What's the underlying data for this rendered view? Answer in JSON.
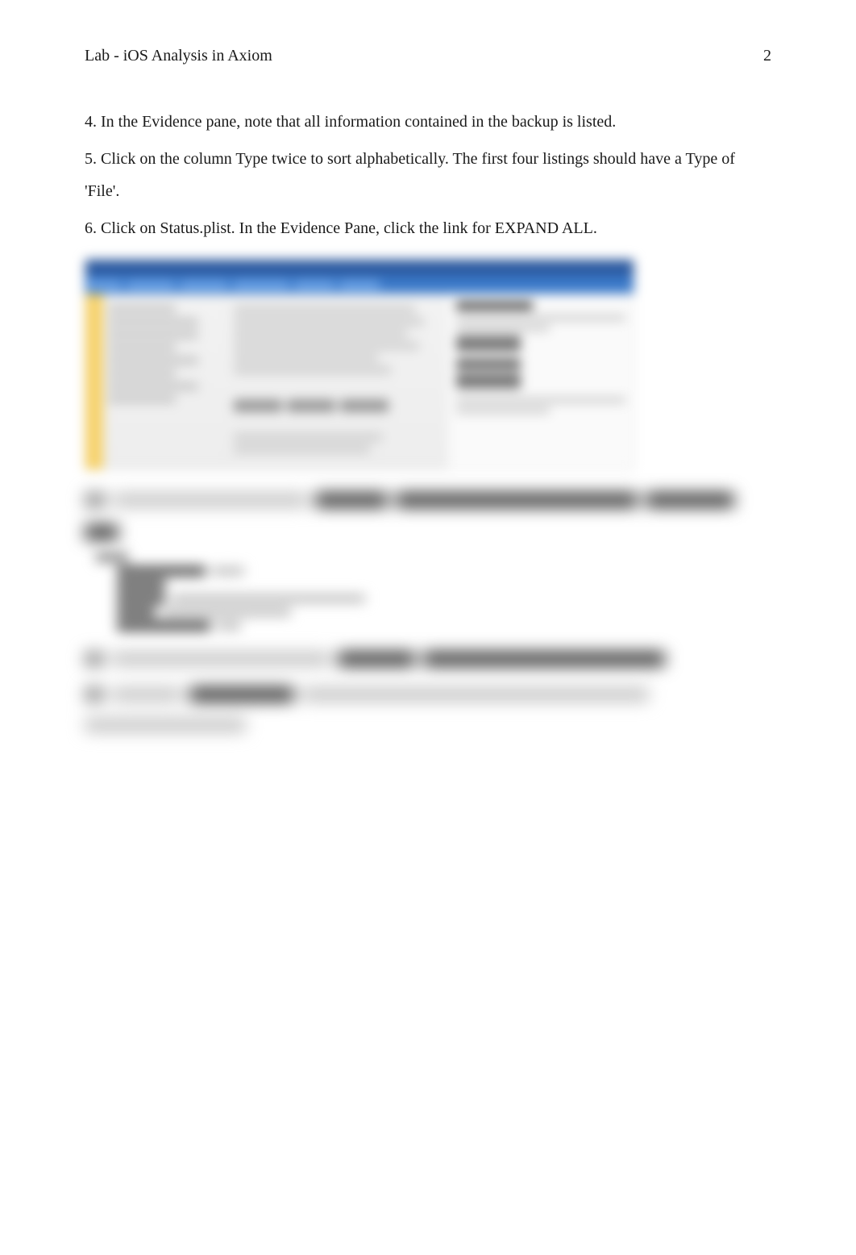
{
  "header": {
    "running_title": "Lab - iOS Analysis in Axiom",
    "page_number": "2"
  },
  "paragraphs": {
    "p4": "4. In the Evidence pane, note that all information contained in the backup is listed.",
    "p5": "5. Click on the column Type twice to sort alphabetically. The first four listings should have a Type of 'File'.",
    "p6": "6. Click on Status.plist. In the Evidence Pane, click the link for EXPAND ALL."
  }
}
